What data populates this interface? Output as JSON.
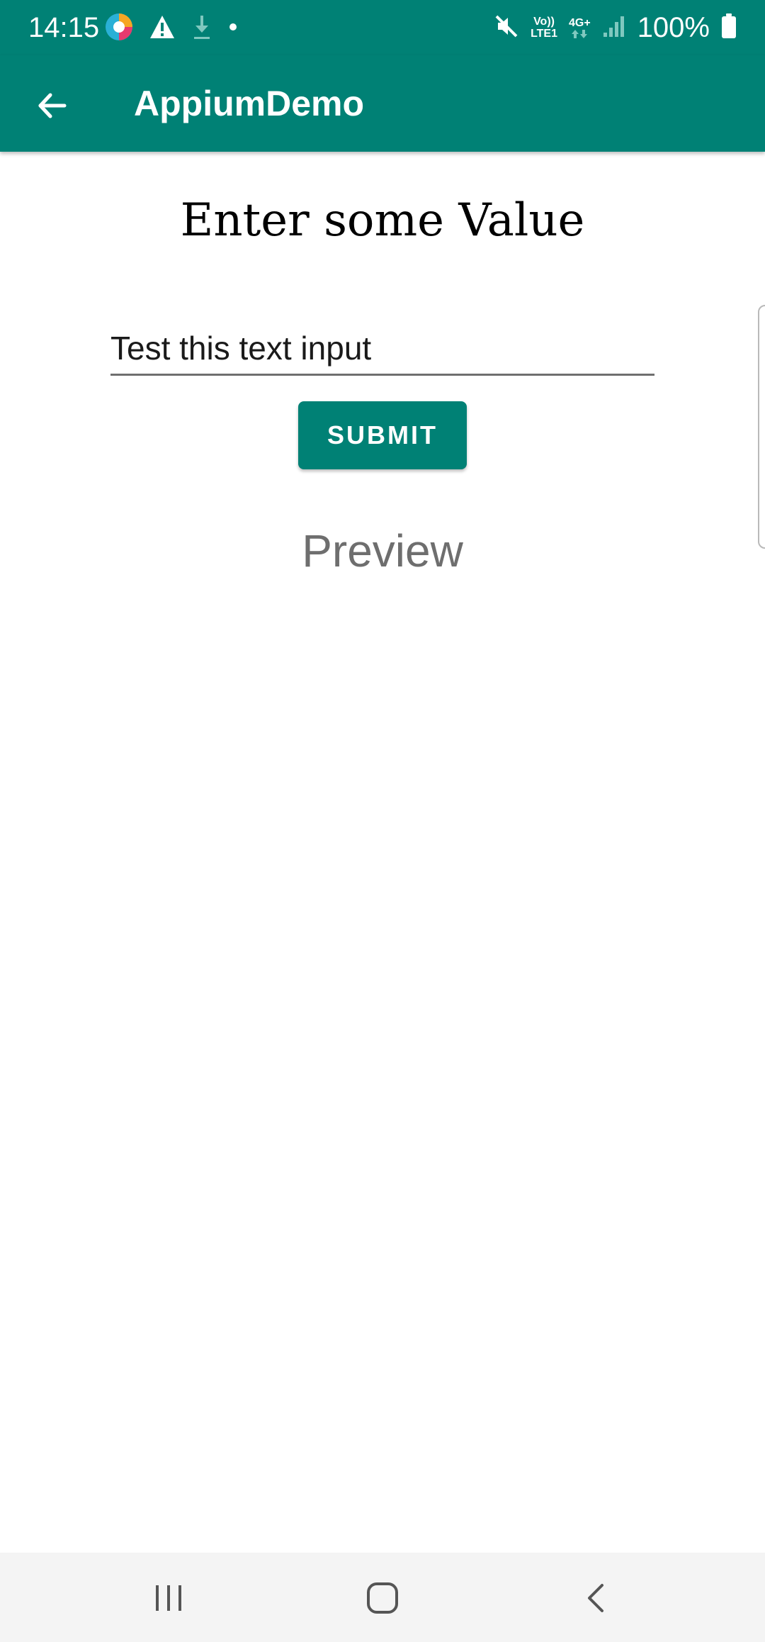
{
  "status_bar": {
    "time": "14:15",
    "battery": "100%",
    "network_top": "Vo))",
    "network_bottom": "LTE1",
    "data_type": "4G+",
    "icons": [
      "browser-icon",
      "warning-icon",
      "download-icon",
      "dot-icon",
      "mute-icon",
      "volte-icon",
      "data-arrows-icon",
      "signal-icon",
      "battery-icon"
    ]
  },
  "app_bar": {
    "title": "AppiumDemo",
    "back_icon": "arrow-left-icon"
  },
  "main": {
    "heading": "Enter some Value",
    "input_value": "Test this text input",
    "submit_label": "SUBMIT",
    "preview_label": "Preview"
  },
  "nav_bar": {
    "icons": [
      "recents-icon",
      "home-icon",
      "back-icon"
    ]
  },
  "colors": {
    "primary": "#008175",
    "preview_text": "#6e6e6e",
    "nav_background": "#f4f4f4"
  }
}
